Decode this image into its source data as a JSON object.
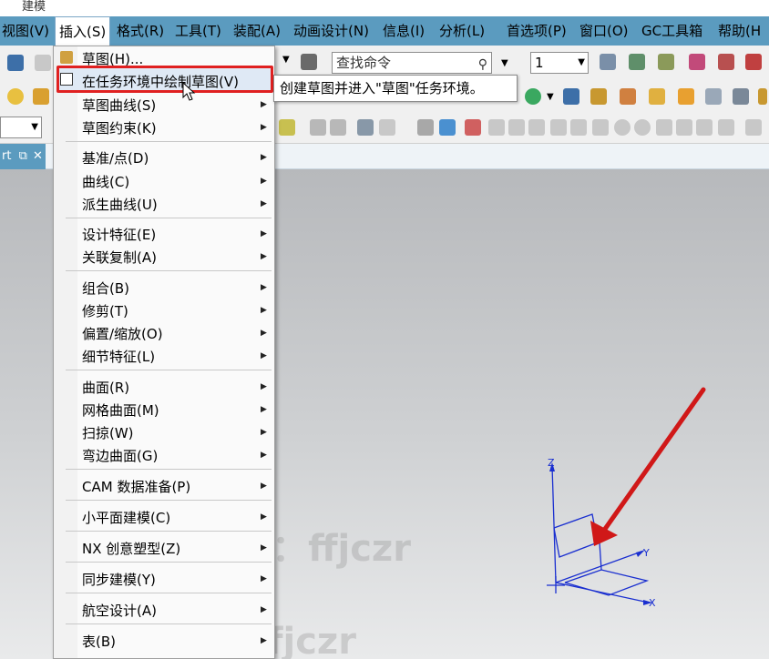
{
  "window": {
    "title_fragment": "建模"
  },
  "menubar": {
    "items": [
      {
        "label": "视图(V)"
      },
      {
        "label": "插入(S)"
      },
      {
        "label": "格式(R)"
      },
      {
        "label": "工具(T)"
      },
      {
        "label": "装配(A)"
      },
      {
        "label": "动画设计(N)"
      },
      {
        "label": "信息(I)"
      },
      {
        "label": "分析(L)"
      },
      {
        "label": "首选项(P)"
      },
      {
        "label": "窗口(O)"
      },
      {
        "label": "GC工具箱"
      },
      {
        "label": "帮助(H"
      }
    ]
  },
  "toolbar": {
    "search_text": "查找命令",
    "layer_value": "1"
  },
  "tab": {
    "label": "rt"
  },
  "insert_menu": {
    "items": [
      {
        "label": "草图(H)..."
      },
      {
        "label": "在任务环境中绘制草图(V)"
      },
      {
        "label": "草图曲线(S)"
      },
      {
        "label": "草图约束(K)"
      },
      {
        "label": "基准/点(D)"
      },
      {
        "label": "曲线(C)"
      },
      {
        "label": "派生曲线(U)"
      },
      {
        "label": "设计特征(E)"
      },
      {
        "label": "关联复制(A)"
      },
      {
        "label": "组合(B)"
      },
      {
        "label": "修剪(T)"
      },
      {
        "label": "偏置/缩放(O)"
      },
      {
        "label": "细节特征(L)"
      },
      {
        "label": "曲面(R)"
      },
      {
        "label": "网格曲面(M)"
      },
      {
        "label": "扫掠(W)"
      },
      {
        "label": "弯边曲面(G)"
      },
      {
        "label": "CAM 数据准备(P)"
      },
      {
        "label": "小平面建模(C)"
      },
      {
        "label": "NX 创意塑型(Z)"
      },
      {
        "label": "同步建模(Y)"
      },
      {
        "label": "航空设计(A)"
      },
      {
        "label": "表(B)"
      }
    ]
  },
  "tooltip": {
    "text": "创建草图并进入\"草图\"任务环境。"
  },
  "triad": {
    "z": "Z",
    "y": "Y",
    "x": "X"
  },
  "watermark": {
    "text": "百度ID：ffjczr"
  },
  "colors": {
    "menubar": "#5b9bbf",
    "highlight_border": "#e02020",
    "arrow": "#d01818",
    "triad": "#1a2fd0"
  }
}
